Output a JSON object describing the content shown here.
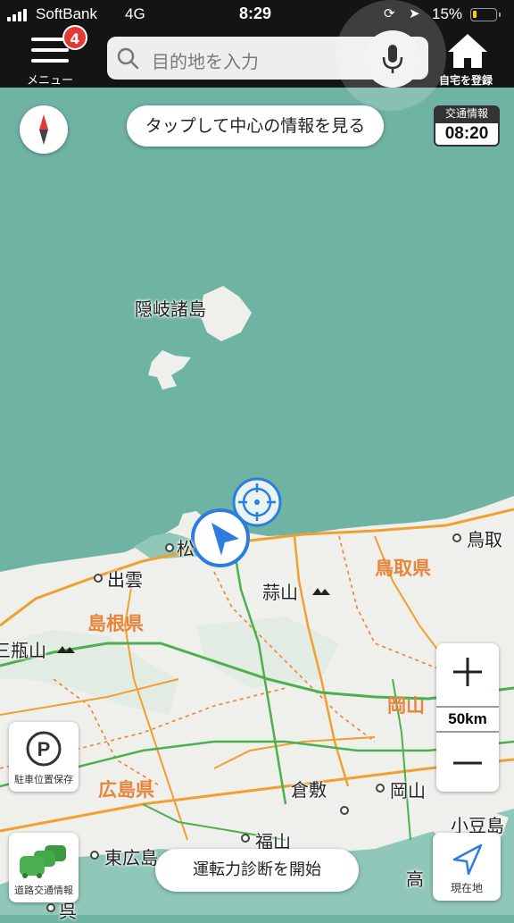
{
  "status_bar": {
    "carrier": "SoftBank",
    "network": "4G",
    "time": "8:29",
    "battery_percent": "15%",
    "battery_level": 0.15
  },
  "toolbar": {
    "menu_label": "メニュー",
    "menu_badge": "4",
    "search_placeholder": "目的地を入力",
    "home_label": "自宅を登録"
  },
  "map_overlay": {
    "center_info": "タップして中心の情報を見る",
    "traffic_title": "交通情報",
    "traffic_time": "08:20"
  },
  "map_labels": {
    "oki": "隠岐諸島",
    "matsue": "松",
    "izumo": "出雲",
    "tottori_city": "鳥取",
    "hiruzen": "蒜山",
    "sanbe": "三瓶山",
    "kurashiki": "倉敷",
    "okayama_city": "岡山",
    "fukuyama": "福山",
    "higashihiroshima": "東広島",
    "shodoshima": "小豆島",
    "kure": "呉",
    "taka": "高"
  },
  "prefectures": {
    "tottori": "鳥取県",
    "shimane": "島根県",
    "okayama": "岡山",
    "hiroshima": "広島県"
  },
  "controls": {
    "zoom_in": "+",
    "zoom_out": "−",
    "scale": "50km",
    "parking_label": "駐車位置保存",
    "road_traffic_label": "道路交通情報",
    "current_location_label": "現在地",
    "drive_diagnosis": "運転力診断を開始"
  },
  "colors": {
    "sea": "#6fb3a3",
    "land": "#efefec",
    "road_orange": "#f0a030",
    "road_green": "#4caf50",
    "prefecture_label": "#e8843c",
    "accent_blue": "#2d7de0"
  }
}
